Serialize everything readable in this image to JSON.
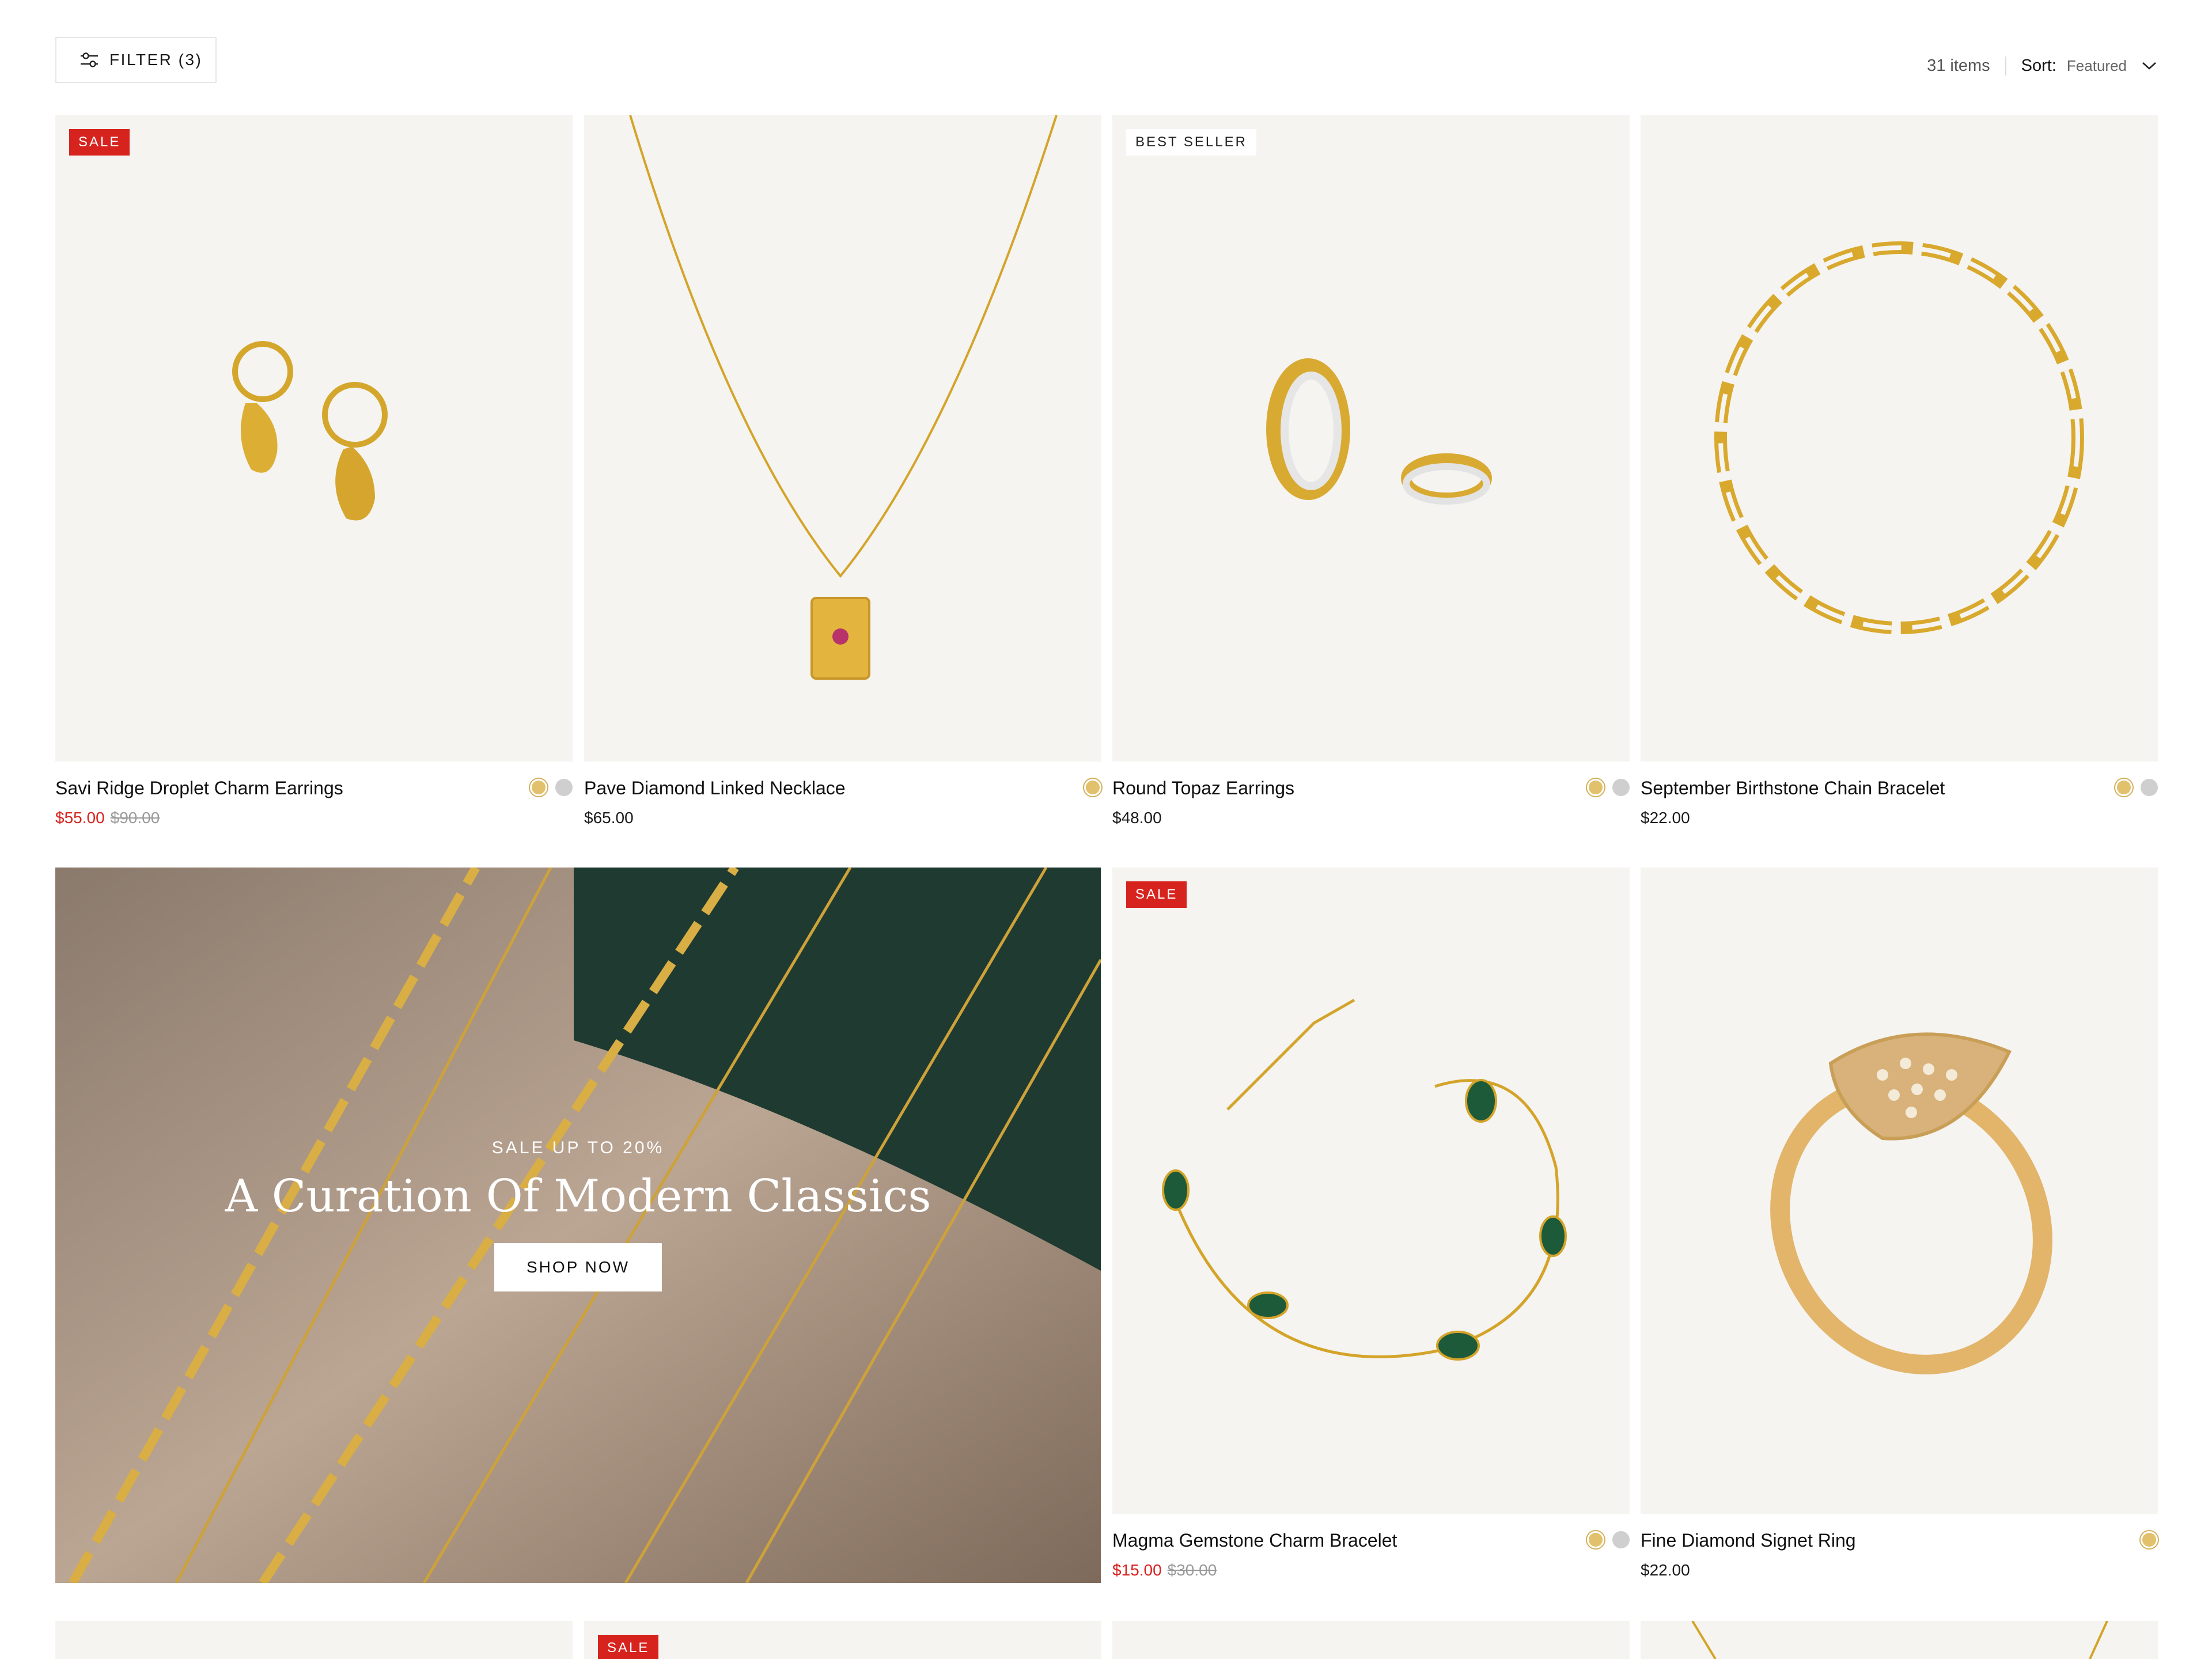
{
  "toolbar": {
    "filter_label": "FILTER (3)",
    "items_count": "31 items",
    "sort_label": "Sort:",
    "sort_value": "Featured"
  },
  "products": [
    {
      "title": "Savi Ridge Droplet Charm Earrings",
      "badge": "SALE",
      "price": "$55.00",
      "compare_price": "$90.00",
      "swatches": [
        "gold",
        "silver"
      ]
    },
    {
      "title": "Pave Diamond Linked Necklace",
      "price": "$65.00",
      "swatches": [
        "gold"
      ]
    },
    {
      "title": "Round Topaz Earrings",
      "badge": "BEST SELLER",
      "price": "$48.00",
      "swatches": [
        "gold",
        "silver"
      ]
    },
    {
      "title": "September Birthstone Chain Bracelet",
      "price": "$22.00",
      "swatches": [
        "gold",
        "silver"
      ]
    },
    {
      "title": "Magma Gemstone Charm Bracelet",
      "badge": "SALE",
      "price": "$15.00",
      "compare_price": "$30.00",
      "swatches": [
        "gold",
        "silver"
      ]
    },
    {
      "title": "Fine Diamond Signet Ring",
      "price": "$22.00",
      "swatches": [
        "gold"
      ]
    }
  ],
  "promo_banner": {
    "eyebrow": "SALE UP TO 20%",
    "title": "A Curation Of Modern Classics",
    "cta_label": "SHOP NOW"
  },
  "next_row": {
    "badge_2": "SALE"
  },
  "colors": {
    "sale_red": "#d6231e",
    "gold_swatch": "#e2c16d",
    "silver_swatch": "#cfcfcf",
    "photo_bg": "#f5f4f1"
  }
}
